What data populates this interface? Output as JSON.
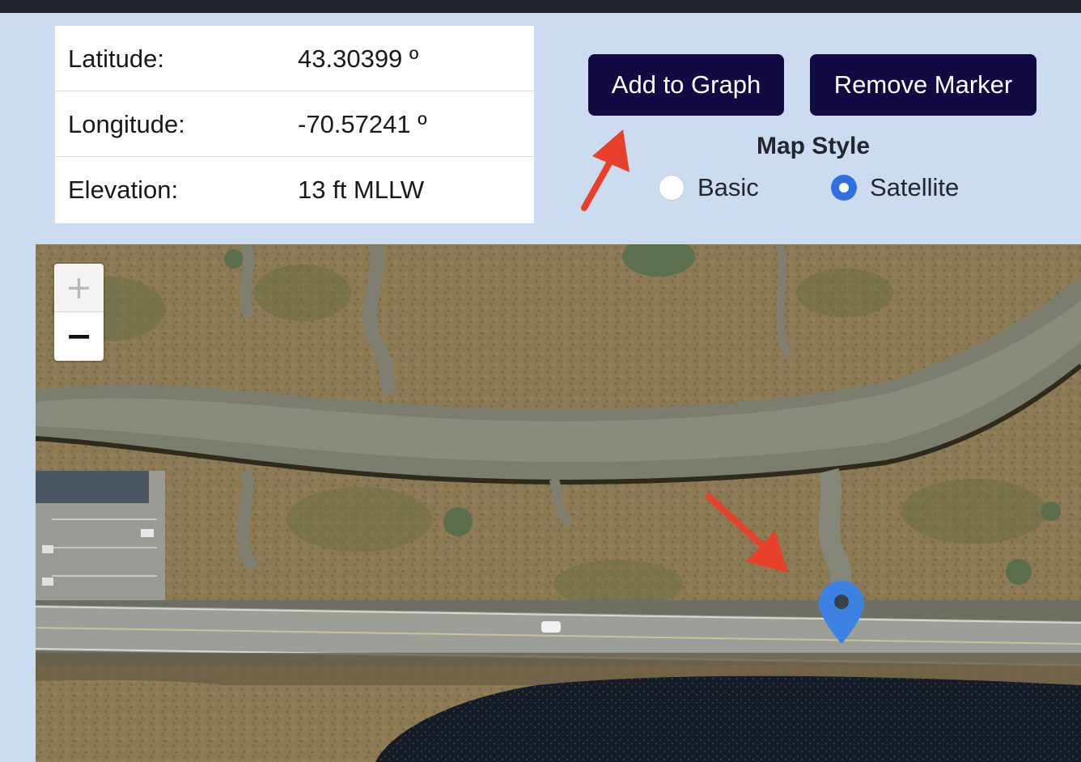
{
  "info": {
    "rows": [
      {
        "label": "Latitude:",
        "value": "43.30399 º"
      },
      {
        "label": "Longitude:",
        "value": "-70.57241 º"
      },
      {
        "label": "Elevation:",
        "value": "13 ft MLLW"
      }
    ]
  },
  "buttons": {
    "add_to_graph": "Add to Graph",
    "remove_marker": "Remove Marker"
  },
  "map_style": {
    "title": "Map Style",
    "options": [
      {
        "label": "Basic",
        "selected": false
      },
      {
        "label": "Satellite",
        "selected": true
      }
    ]
  },
  "zoom": {
    "in": "+",
    "out": "−"
  },
  "colors": {
    "page_bg": "#cbdcf1",
    "button_bg": "#120a42",
    "radio_accent": "#2f6fe0",
    "marker": "#3d82e3",
    "annotation_arrow": "#e8412b"
  },
  "icons": {
    "marker": "map-pin-icon",
    "annotations": "red-arrow-icon"
  }
}
